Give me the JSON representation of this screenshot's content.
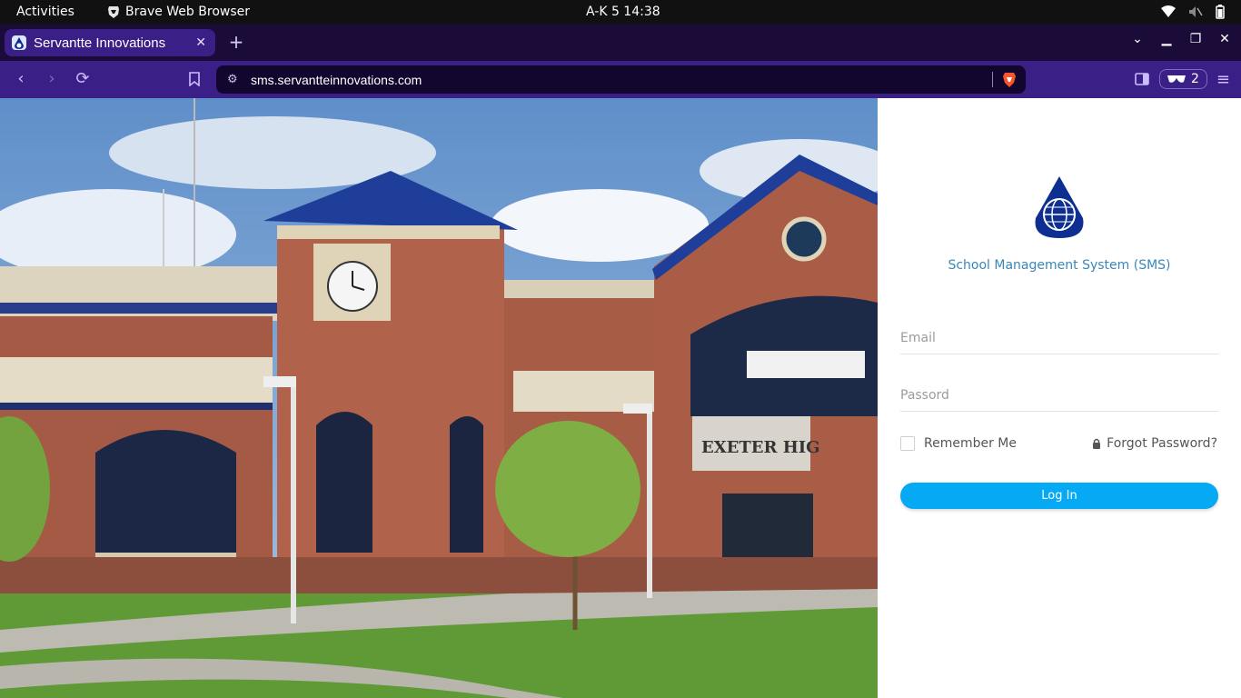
{
  "topbar": {
    "activities": "Activities",
    "app_name": "Brave Web Browser",
    "clock": "A-K 5  14:38"
  },
  "tab": {
    "title": "Servantte Innovations"
  },
  "addressbar": {
    "url": "sms.servantteinnovations.com",
    "shield_count": "2"
  },
  "login": {
    "system_name": "School Management System (SMS)",
    "email_placeholder": "Email",
    "password_placeholder": "Passord",
    "remember_label": "Remember Me",
    "forgot_label": "Forgot Password?",
    "login_label": "Log In"
  },
  "hero": {
    "sign_text": "EXETER HIG"
  },
  "colors": {
    "accent": "#06a9f4",
    "brand_text": "#3a86bb",
    "logo_blue": "#0e2f91",
    "tabbar": "#3a1f86"
  }
}
